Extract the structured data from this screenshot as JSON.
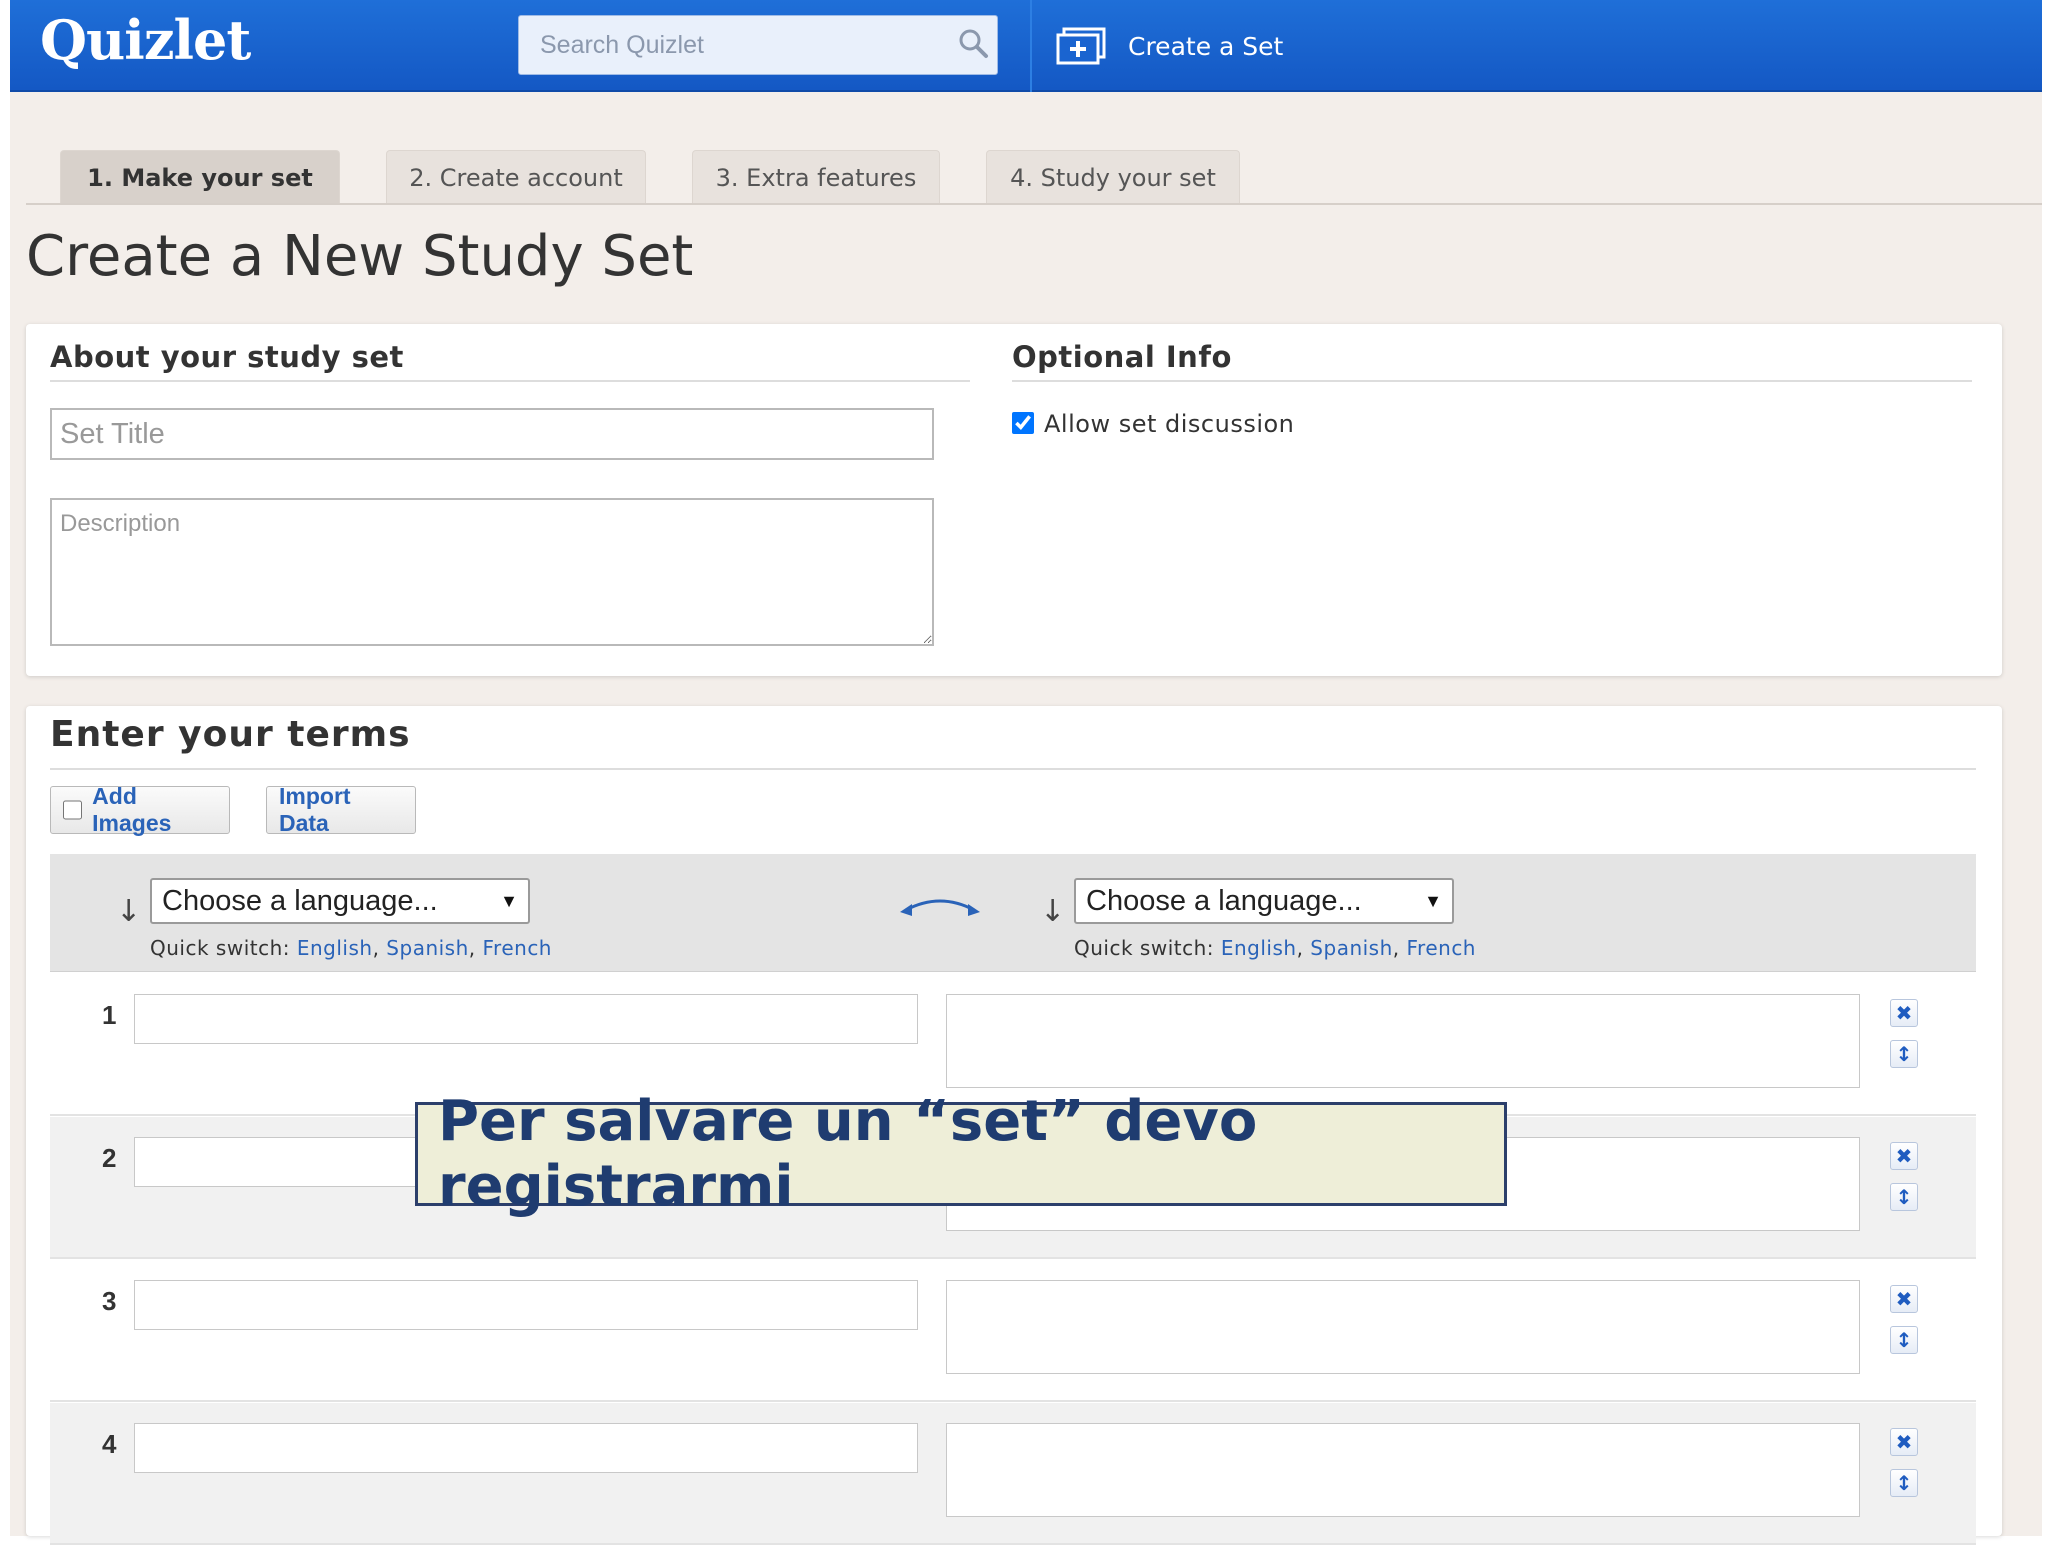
{
  "header": {
    "logo": "Quizlet",
    "search_placeholder": "Search Quizlet",
    "create_set_label": "Create a Set",
    "brand_color": "#1a64d0"
  },
  "steps": [
    {
      "label": "1. Make your set",
      "active": true
    },
    {
      "label": "2. Create account",
      "active": false
    },
    {
      "label": "3. Extra features",
      "active": false
    },
    {
      "label": "4. Study your set",
      "active": false
    }
  ],
  "page_title": "Create a New Study Set",
  "about": {
    "heading": "About your study set",
    "title_placeholder": "Set Title",
    "description_placeholder": "Description"
  },
  "optional": {
    "heading": "Optional Info",
    "allow_discussion_label": "Allow set discussion",
    "allow_discussion_checked": true
  },
  "terms": {
    "heading": "Enter your terms",
    "add_images_label": "Add Images",
    "import_label": "Import Data",
    "left_language": {
      "select_value": "Choose a language...",
      "quick_switch_label": "Quick switch:",
      "quick_links": [
        "English",
        "Spanish",
        "French"
      ]
    },
    "right_language": {
      "select_value": "Choose a language...",
      "quick_switch_label": "Quick switch:",
      "quick_links": [
        "English",
        "Spanish",
        "French"
      ]
    },
    "rows": [
      {
        "number": "1",
        "term": "",
        "definition": ""
      },
      {
        "number": "2",
        "term": "",
        "definition": ""
      },
      {
        "number": "3",
        "term": "",
        "definition": ""
      },
      {
        "number": "4",
        "term": "",
        "definition": ""
      }
    ],
    "link_color": "#2a63b8"
  },
  "callout": {
    "text": "Per salvare un “set” devo registrarmi"
  }
}
